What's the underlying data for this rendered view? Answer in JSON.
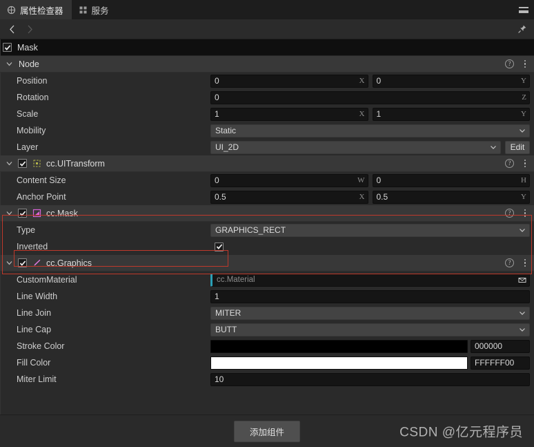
{
  "window": {
    "menu_icon": "hamburger-icon"
  },
  "tabs": [
    {
      "label": "属性检查器",
      "icon": "inspector-icon",
      "active": true
    },
    {
      "label": "服务",
      "icon": "grid-icon",
      "active": false
    }
  ],
  "navbar": {
    "back_icon": "chevron-left-icon",
    "forward_icon": "chevron-right-icon",
    "pin_icon": "pin-icon"
  },
  "node": {
    "name": "Mask",
    "enabled": true
  },
  "icons": {
    "help": "question-mark-icon",
    "menu": "vertical-dots-icon",
    "chevron_down": "chevron-down-icon",
    "caret_down": "caret-down-icon",
    "lock": "asset-picker-icon",
    "check": "checkmark-icon"
  },
  "colors": {
    "highlight": "#c0392b",
    "accent_cyan": "#2a9fb5",
    "panel_bg": "#2a2a2a",
    "section_bg": "#383838",
    "input_bg": "#151515",
    "dropdown_bg": "#434343"
  },
  "sections": [
    {
      "id": "node",
      "title": "Node",
      "has_checkbox": false,
      "icon": null,
      "rows": [
        {
          "label": "Position",
          "type": "vec2",
          "fields": [
            {
              "value": "0",
              "axis": "X"
            },
            {
              "value": "0",
              "axis": "Y"
            }
          ]
        },
        {
          "label": "Rotation",
          "type": "vec1",
          "fields": [
            {
              "value": "0",
              "axis": "Z"
            }
          ]
        },
        {
          "label": "Scale",
          "type": "vec2",
          "fields": [
            {
              "value": "1",
              "axis": "X"
            },
            {
              "value": "1",
              "axis": "Y"
            }
          ]
        },
        {
          "label": "Mobility",
          "type": "dropdown",
          "value": "Static"
        },
        {
          "label": "Layer",
          "type": "dropdown-edit",
          "value": "UI_2D",
          "button": "Edit"
        }
      ]
    },
    {
      "id": "uitransform",
      "title": "cc.UITransform",
      "has_checkbox": true,
      "checked": true,
      "icon": "uitransform-icon",
      "rows": [
        {
          "label": "Content Size",
          "type": "vec2",
          "fields": [
            {
              "value": "0",
              "axis": "W"
            },
            {
              "value": "0",
              "axis": "H"
            }
          ]
        },
        {
          "label": "Anchor Point",
          "type": "vec2",
          "fields": [
            {
              "value": "0.5",
              "axis": "X"
            },
            {
              "value": "0.5",
              "axis": "Y"
            }
          ]
        }
      ]
    },
    {
      "id": "mask",
      "title": "cc.Mask",
      "has_checkbox": true,
      "checked": true,
      "icon": "mask-icon",
      "rows": [
        {
          "label": "Type",
          "type": "dropdown",
          "value": "GRAPHICS_RECT"
        },
        {
          "label": "Inverted",
          "type": "checkbox",
          "checked": true
        }
      ]
    },
    {
      "id": "graphics",
      "title": "cc.Graphics",
      "has_checkbox": true,
      "checked": true,
      "icon": "graphics-pen-icon",
      "rows": [
        {
          "label": "CustomMaterial",
          "type": "assetref",
          "placeholder": "cc.Material"
        },
        {
          "label": "Line Width",
          "type": "vec1-plain",
          "fields": [
            {
              "value": "1",
              "axis": ""
            }
          ]
        },
        {
          "label": "Line Join",
          "type": "dropdown",
          "value": "MITER"
        },
        {
          "label": "Line Cap",
          "type": "dropdown",
          "value": "BUTT"
        },
        {
          "label": "Stroke Color",
          "type": "color",
          "swatch": "#000000",
          "hex": "000000"
        },
        {
          "label": "Fill Color",
          "type": "color",
          "swatch": "#ffffff",
          "hex": "FFFFFF00"
        },
        {
          "label": "Miter Limit",
          "type": "vec1-plain",
          "fields": [
            {
              "value": "10",
              "axis": ""
            }
          ]
        }
      ]
    }
  ],
  "footer": {
    "add_component_label": "添加组件",
    "watermark": "CSDN @亿元程序员"
  }
}
